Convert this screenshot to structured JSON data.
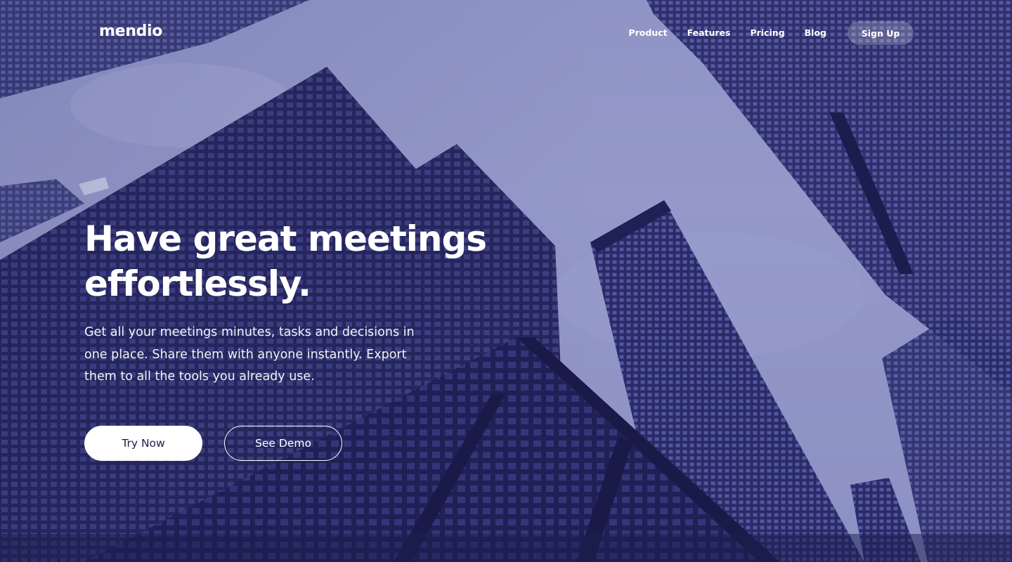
{
  "brand": {
    "name": "mendio"
  },
  "nav": {
    "links": [
      "Product",
      "Features",
      "Pricing",
      "Blog"
    ],
    "signup_label": "Sign Up"
  },
  "hero": {
    "headline_line1": "Have great meetings",
    "headline_line2": "effortlessly.",
    "subtext": "Get all your meetings minutes, tasks and decisions in one place. Share them with anyone instantly. Export them to all the tools you already use.",
    "primary_cta": "Try Now",
    "secondary_cta": "See Demo",
    "background_image": "city-skyscrapers-photo"
  },
  "colors": {
    "overlay": "#8f94c6",
    "building_dark": "#23245a",
    "button_text": "#1d1e46"
  }
}
